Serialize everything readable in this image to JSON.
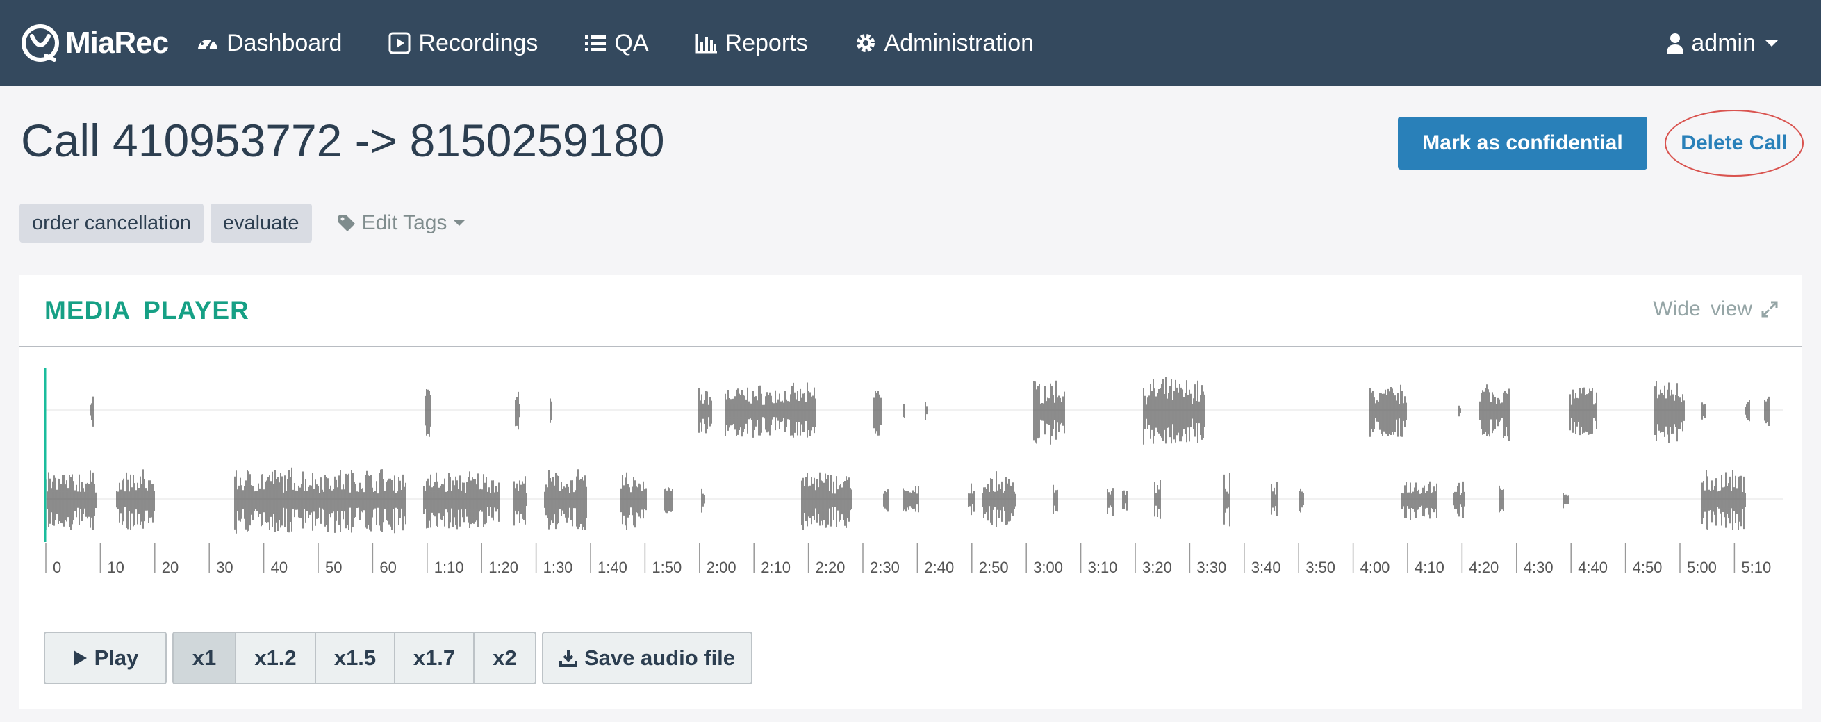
{
  "brand": {
    "name": "MiaRec"
  },
  "nav": {
    "items": [
      {
        "label": "Dashboard",
        "icon": "dashboard-icon"
      },
      {
        "label": "Recordings",
        "icon": "play-square-icon"
      },
      {
        "label": "QA",
        "icon": "list-icon"
      },
      {
        "label": "Reports",
        "icon": "bar-chart-icon"
      },
      {
        "label": "Administration",
        "icon": "gear-icon"
      }
    ],
    "user": "admin"
  },
  "page": {
    "title": "Call 410953772 -> 8150259180",
    "confidential_label": "Mark as confidential",
    "delete_label": "Delete Call"
  },
  "tags": {
    "items": [
      "order cancellation",
      "evaluate"
    ],
    "edit_label": "Edit Tags"
  },
  "media_player": {
    "title": "MEDIA PLAYER",
    "wide_view_label": "Wide view",
    "time_labels": [
      "0",
      "10",
      "20",
      "30",
      "40",
      "50",
      "60",
      "1:10",
      "1:20",
      "1:30",
      "1:40",
      "1:50",
      "2:00",
      "2:10",
      "2:20",
      "2:30",
      "2:40",
      "2:50",
      "3:00",
      "3:10",
      "3:20",
      "3:30",
      "3:40",
      "3:50",
      "4:00",
      "4:10",
      "4:20",
      "4:30",
      "4:40",
      "4:50",
      "5:00",
      "5:10"
    ],
    "play_label": "Play",
    "speeds": [
      "x1",
      "x1.2",
      "x1.5",
      "x1.7",
      "x2"
    ],
    "active_speed": "x1",
    "save_label": "Save audio file"
  },
  "colors": {
    "navbar": "#34495e",
    "primary": "#2980b9",
    "accent": "#16a085",
    "delete_highlight": "#d9534f",
    "waveform": "#5a5a5a",
    "cursor": "#1abc9c"
  }
}
